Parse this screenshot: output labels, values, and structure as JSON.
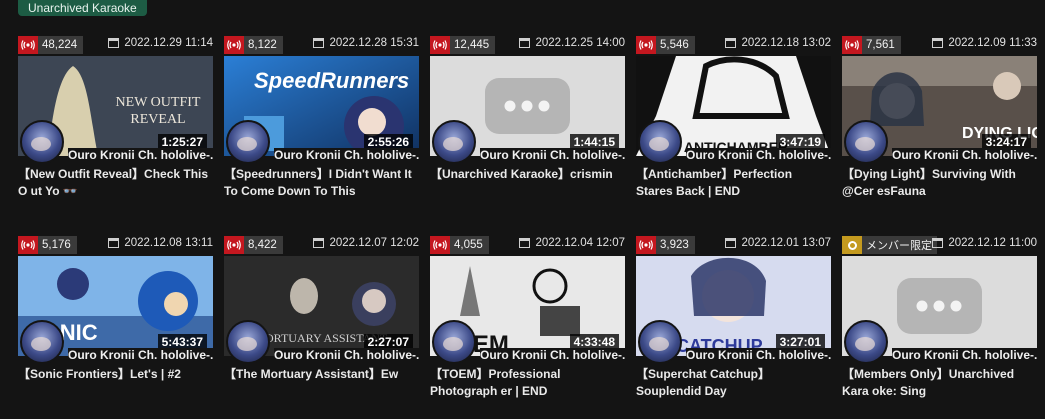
{
  "header": {
    "tag": "Unarchived Karaoke"
  },
  "channel_name": "Ouro Kronii Ch. hololive-...",
  "cards": [
    {
      "viewers": "48,224",
      "date": "2022.12.29 11:14",
      "duration": "1:25:27",
      "title": "【New Outfit Reveal】Check This O ut Yo 👓",
      "thumb": "new-outfit",
      "thumb_text": "NEW OUTFIT\nREVEAL"
    },
    {
      "viewers": "8,122",
      "date": "2022.12.28 15:31",
      "duration": "2:55:26",
      "title": "【Speedrunners】I Didn't Want It To Come Down To This",
      "thumb": "speedrunners",
      "thumb_text": "SpeedRunners"
    },
    {
      "viewers": "12,445",
      "date": "2022.12.25 14:00",
      "duration": "1:44:15",
      "title": "【Unarchived Karaoke】crismin",
      "thumb": "placeholder",
      "thumb_text": ""
    },
    {
      "viewers": "5,546",
      "date": "2022.12.18 13:02",
      "duration": "3:47:19",
      "title": "【Antichamber】Perfection Stares Back | END",
      "thumb": "antichamber",
      "thumb_text": "ANTICHAMBER"
    },
    {
      "viewers": "7,561",
      "date": "2022.12.09 11:33",
      "duration": "3:24:17",
      "title": "【Dying Light】Surviving With @Cer esFauna",
      "thumb": "dying-light",
      "thumb_text": "DYING LIGHT"
    },
    {
      "viewers": "5,176",
      "date": "2022.12.08 13:11",
      "duration": "5:43:37",
      "title": "【Sonic Frontiers】Let's | #2",
      "thumb": "sonic",
      "thumb_text": "SONIC"
    },
    {
      "viewers": "8,422",
      "date": "2022.12.07 12:02",
      "duration": "2:27:07",
      "title": "【The Mortuary Assistant】Ew",
      "thumb": "mortuary",
      "thumb_text": "THE MORTUARY ASSISTANT"
    },
    {
      "viewers": "4,055",
      "date": "2022.12.04 12:07",
      "duration": "4:33:48",
      "title": "【TOEM】Professional Photograph er | END",
      "thumb": "toem",
      "thumb_text": "TOEM"
    },
    {
      "viewers": "3,923",
      "date": "2022.12.01 13:07",
      "duration": "3:27:01",
      "title": "【Superchat Catchup】Souplendid Day",
      "thumb": "catchup",
      "thumb_text": "CATCHUP"
    },
    {
      "member_label": "メンバー限定",
      "date": "2022.12.12 11:00",
      "duration": "",
      "title": "【Members Only】Unarchived Kara oke: Sing",
      "thumb": "placeholder",
      "thumb_text": ""
    }
  ]
}
